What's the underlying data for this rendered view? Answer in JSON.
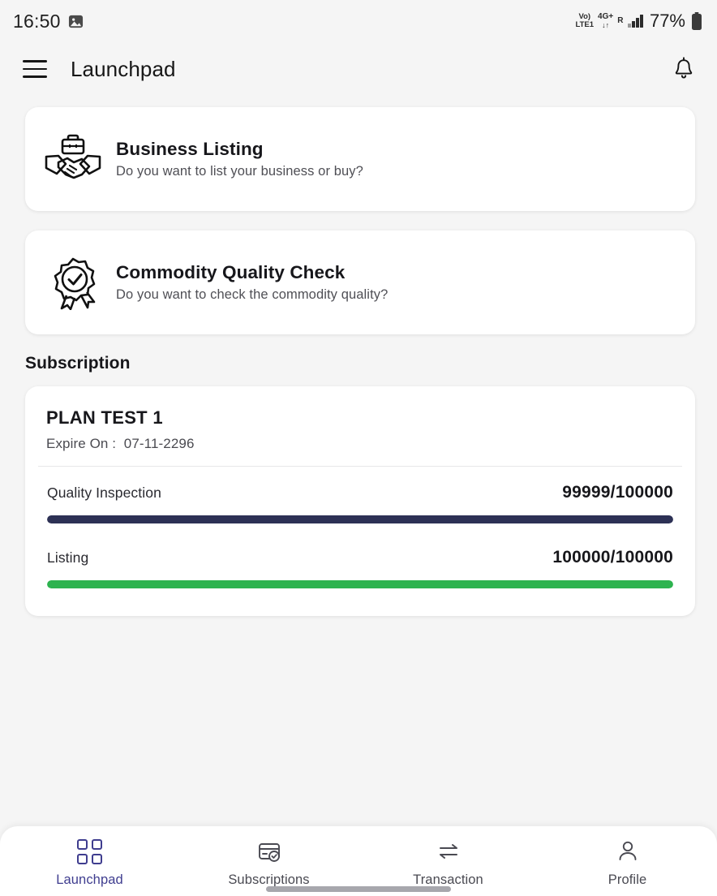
{
  "status_bar": {
    "time": "16:50",
    "image_icon": "image-icon",
    "volte_top": "Vo)",
    "volte_bottom": "LTE1",
    "network_top": "4G+",
    "network_arrows": "↓↑",
    "roaming": "R",
    "battery_percent": "77%",
    "battery_icon": "battery-icon"
  },
  "app_bar": {
    "menu_icon": "hamburger-menu-icon",
    "title": "Launchpad",
    "notification_icon": "bell-icon"
  },
  "cards": [
    {
      "icon": "handshake-briefcase-icon",
      "title": "Business Listing",
      "subtitle": "Do you want to list your business or buy?"
    },
    {
      "icon": "quality-badge-icon",
      "title": "Commodity Quality Check",
      "subtitle": "Do you want to check the commodity quality?"
    }
  ],
  "subscription": {
    "section_title": "Subscription",
    "plan_name": "PLAN TEST 1",
    "expire_label": "Expire On :",
    "expire_date": "07-11-2296",
    "usages": [
      {
        "label": "Quality Inspection",
        "value": "99999/100000",
        "used": 99999,
        "total": 100000,
        "percent": 100,
        "color": "#2d3155"
      },
      {
        "label": "Listing",
        "value": "100000/100000",
        "used": 100000,
        "total": 100000,
        "percent": 100,
        "color": "#2db34f"
      }
    ]
  },
  "bottom_nav": {
    "active_color": "#3f3d8f",
    "items": [
      {
        "icon": "grid-launchpad-icon",
        "label": "Launchpad",
        "active": true
      },
      {
        "icon": "card-check-icon",
        "label": "Subscriptions",
        "active": false
      },
      {
        "icon": "exchange-arrows-icon",
        "label": "Transaction",
        "active": false
      },
      {
        "icon": "person-icon",
        "label": "Profile",
        "active": false
      }
    ]
  }
}
